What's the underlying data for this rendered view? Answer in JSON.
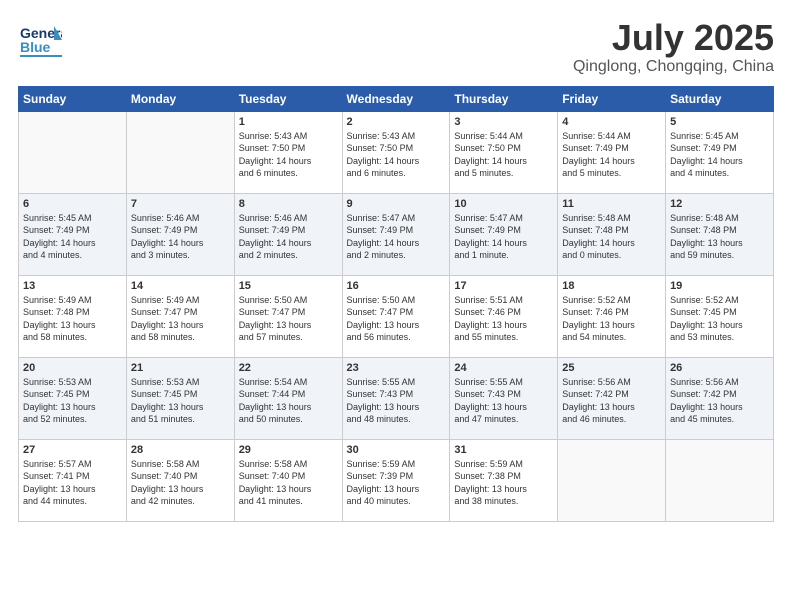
{
  "header": {
    "logo_line1": "General",
    "logo_line2": "Blue",
    "month": "July 2025",
    "location": "Qinglong, Chongqing, China"
  },
  "days_of_week": [
    "Sunday",
    "Monday",
    "Tuesday",
    "Wednesday",
    "Thursday",
    "Friday",
    "Saturday"
  ],
  "weeks": [
    [
      {
        "day": "",
        "info": ""
      },
      {
        "day": "",
        "info": ""
      },
      {
        "day": "1",
        "info": "Sunrise: 5:43 AM\nSunset: 7:50 PM\nDaylight: 14 hours\nand 6 minutes."
      },
      {
        "day": "2",
        "info": "Sunrise: 5:43 AM\nSunset: 7:50 PM\nDaylight: 14 hours\nand 6 minutes."
      },
      {
        "day": "3",
        "info": "Sunrise: 5:44 AM\nSunset: 7:50 PM\nDaylight: 14 hours\nand 5 minutes."
      },
      {
        "day": "4",
        "info": "Sunrise: 5:44 AM\nSunset: 7:49 PM\nDaylight: 14 hours\nand 5 minutes."
      },
      {
        "day": "5",
        "info": "Sunrise: 5:45 AM\nSunset: 7:49 PM\nDaylight: 14 hours\nand 4 minutes."
      }
    ],
    [
      {
        "day": "6",
        "info": "Sunrise: 5:45 AM\nSunset: 7:49 PM\nDaylight: 14 hours\nand 4 minutes."
      },
      {
        "day": "7",
        "info": "Sunrise: 5:46 AM\nSunset: 7:49 PM\nDaylight: 14 hours\nand 3 minutes."
      },
      {
        "day": "8",
        "info": "Sunrise: 5:46 AM\nSunset: 7:49 PM\nDaylight: 14 hours\nand 2 minutes."
      },
      {
        "day": "9",
        "info": "Sunrise: 5:47 AM\nSunset: 7:49 PM\nDaylight: 14 hours\nand 2 minutes."
      },
      {
        "day": "10",
        "info": "Sunrise: 5:47 AM\nSunset: 7:49 PM\nDaylight: 14 hours\nand 1 minute."
      },
      {
        "day": "11",
        "info": "Sunrise: 5:48 AM\nSunset: 7:48 PM\nDaylight: 14 hours\nand 0 minutes."
      },
      {
        "day": "12",
        "info": "Sunrise: 5:48 AM\nSunset: 7:48 PM\nDaylight: 13 hours\nand 59 minutes."
      }
    ],
    [
      {
        "day": "13",
        "info": "Sunrise: 5:49 AM\nSunset: 7:48 PM\nDaylight: 13 hours\nand 58 minutes."
      },
      {
        "day": "14",
        "info": "Sunrise: 5:49 AM\nSunset: 7:47 PM\nDaylight: 13 hours\nand 58 minutes."
      },
      {
        "day": "15",
        "info": "Sunrise: 5:50 AM\nSunset: 7:47 PM\nDaylight: 13 hours\nand 57 minutes."
      },
      {
        "day": "16",
        "info": "Sunrise: 5:50 AM\nSunset: 7:47 PM\nDaylight: 13 hours\nand 56 minutes."
      },
      {
        "day": "17",
        "info": "Sunrise: 5:51 AM\nSunset: 7:46 PM\nDaylight: 13 hours\nand 55 minutes."
      },
      {
        "day": "18",
        "info": "Sunrise: 5:52 AM\nSunset: 7:46 PM\nDaylight: 13 hours\nand 54 minutes."
      },
      {
        "day": "19",
        "info": "Sunrise: 5:52 AM\nSunset: 7:45 PM\nDaylight: 13 hours\nand 53 minutes."
      }
    ],
    [
      {
        "day": "20",
        "info": "Sunrise: 5:53 AM\nSunset: 7:45 PM\nDaylight: 13 hours\nand 52 minutes."
      },
      {
        "day": "21",
        "info": "Sunrise: 5:53 AM\nSunset: 7:45 PM\nDaylight: 13 hours\nand 51 minutes."
      },
      {
        "day": "22",
        "info": "Sunrise: 5:54 AM\nSunset: 7:44 PM\nDaylight: 13 hours\nand 50 minutes."
      },
      {
        "day": "23",
        "info": "Sunrise: 5:55 AM\nSunset: 7:43 PM\nDaylight: 13 hours\nand 48 minutes."
      },
      {
        "day": "24",
        "info": "Sunrise: 5:55 AM\nSunset: 7:43 PM\nDaylight: 13 hours\nand 47 minutes."
      },
      {
        "day": "25",
        "info": "Sunrise: 5:56 AM\nSunset: 7:42 PM\nDaylight: 13 hours\nand 46 minutes."
      },
      {
        "day": "26",
        "info": "Sunrise: 5:56 AM\nSunset: 7:42 PM\nDaylight: 13 hours\nand 45 minutes."
      }
    ],
    [
      {
        "day": "27",
        "info": "Sunrise: 5:57 AM\nSunset: 7:41 PM\nDaylight: 13 hours\nand 44 minutes."
      },
      {
        "day": "28",
        "info": "Sunrise: 5:58 AM\nSunset: 7:40 PM\nDaylight: 13 hours\nand 42 minutes."
      },
      {
        "day": "29",
        "info": "Sunrise: 5:58 AM\nSunset: 7:40 PM\nDaylight: 13 hours\nand 41 minutes."
      },
      {
        "day": "30",
        "info": "Sunrise: 5:59 AM\nSunset: 7:39 PM\nDaylight: 13 hours\nand 40 minutes."
      },
      {
        "day": "31",
        "info": "Sunrise: 5:59 AM\nSunset: 7:38 PM\nDaylight: 13 hours\nand 38 minutes."
      },
      {
        "day": "",
        "info": ""
      },
      {
        "day": "",
        "info": ""
      }
    ]
  ]
}
